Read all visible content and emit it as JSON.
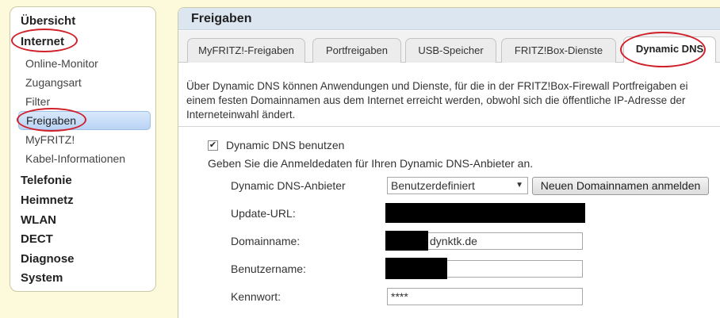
{
  "sidebar": {
    "top_items": [
      "Übersicht",
      "Internet"
    ],
    "sub_items": [
      "Online-Monitor",
      "Zugangsart",
      "Filter",
      "Freigaben",
      "MyFRITZ!",
      "Kabel-Informationen"
    ],
    "bottom_items": [
      "Telefonie",
      "Heimnetz",
      "WLAN",
      "DECT",
      "Diagnose",
      "System"
    ]
  },
  "main": {
    "title": "Freigaben",
    "tabs": [
      "MyFRITZ!-Freigaben",
      "Portfreigaben",
      "USB-Speicher",
      "FRITZ!Box-Dienste",
      "Dynamic DNS"
    ],
    "description": [
      "Über Dynamic DNS können Anwendungen und Dienste, für die in der FRITZ!Box-Firewall Portfreigaben ei",
      "einem festen Domainnamen aus dem Internet erreicht werden, obwohl sich die öffentliche IP-Adresse der",
      "Interneteinwahl ändert."
    ],
    "use_dyndns_label": "Dynamic DNS benutzen",
    "use_dyndns_checked": true,
    "hint": "Geben Sie die Anmeldedaten für Ihren Dynamic DNS-Anbieter an.",
    "provider_label": "Dynamic DNS-Anbieter",
    "provider_value": "Benutzerdefiniert",
    "register_button": "Neuen Domainnamen anmelden",
    "update_url_label": "Update-URL:",
    "domain_label": "Domainname:",
    "domain_value": "dynktk.de",
    "user_label": "Benutzername:",
    "password_label": "Kennwort:",
    "password_value": "****"
  },
  "colors": {
    "highlight_ring": "#d0202a",
    "header_bg": "#dce6f0",
    "page_bg": "#fdfadc"
  }
}
